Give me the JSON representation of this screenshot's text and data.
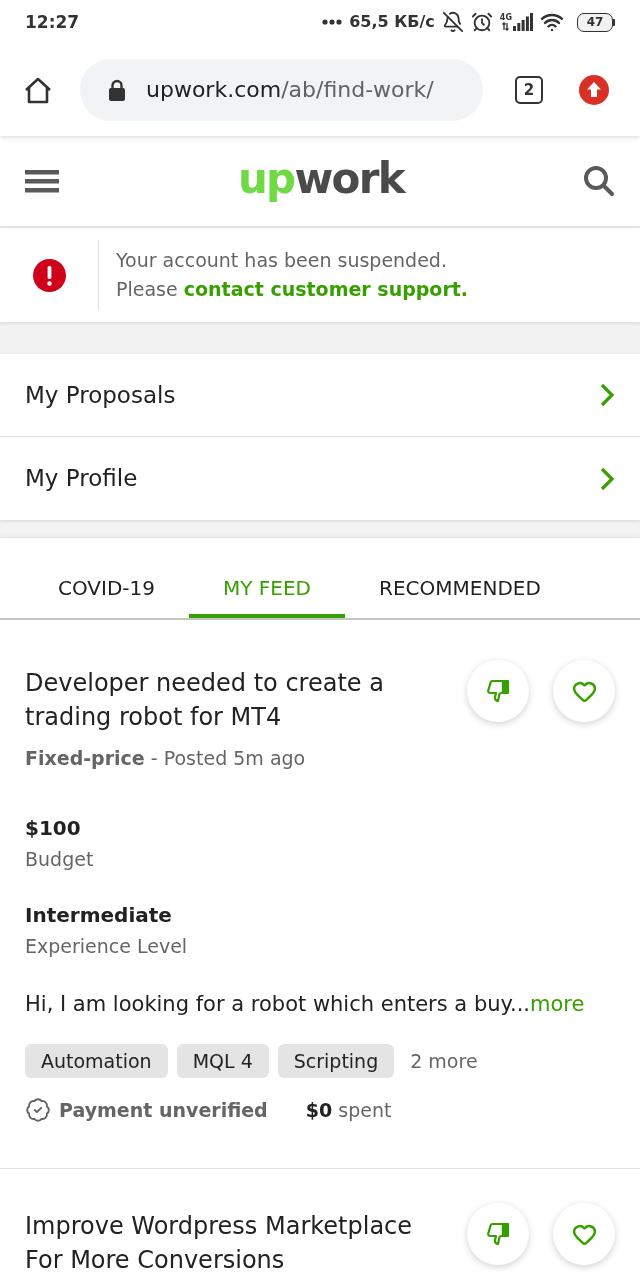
{
  "status_bar": {
    "time": "12:27",
    "network_speed": "65,5 КБ/с",
    "network_type": "4G",
    "battery": "47"
  },
  "browser": {
    "url_host": "upwork.com",
    "url_path": "/ab/find-work/",
    "tab_count": "2"
  },
  "header": {
    "logo_accent": "up",
    "logo_rest": "work"
  },
  "alert": {
    "message": "Your account has been suspended.",
    "prompt": "Please",
    "link": "contact customer support."
  },
  "menu": [
    {
      "label": "My Proposals"
    },
    {
      "label": "My Profile"
    }
  ],
  "tabs": [
    {
      "label": "COVID-19",
      "selected": false
    },
    {
      "label": "MY FEED",
      "selected": true
    },
    {
      "label": "RECOMMENDED",
      "selected": false
    }
  ],
  "jobs": [
    {
      "title": "Developer needed to create a trading robot for MT4",
      "meta": "**Fixed-price** - Posted 5m ago",
      "details": [
        {
          "value": "$100",
          "label": "Budget"
        },
        {
          "value": "Intermediate",
          "label": "Experience Level"
        }
      ],
      "description": "Hi, I am looking for a robot which enters a buy...",
      "more_link": "more",
      "skills": [
        "Automation",
        "MQL 4",
        "Scripting"
      ],
      "more_skills": "2 more",
      "payment": "Payment unverified",
      "spent": "**$0** spent"
    },
    {
      "title": "Improve Wordpress Marketplace For More Conversions"
    }
  ]
}
